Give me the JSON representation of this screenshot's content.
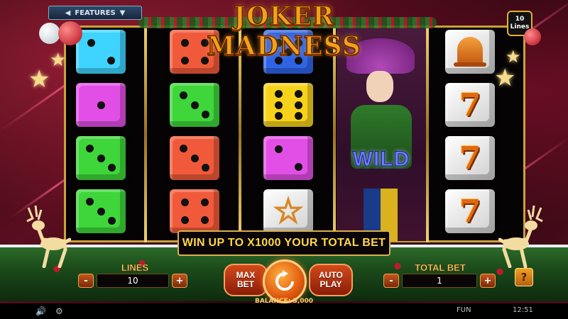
{
  "title": "JOKER MADNESS",
  "features_label": "FEATURES",
  "lines_badge": {
    "value": "10",
    "label": "Lines"
  },
  "wild_label": "WILD",
  "win_banner": "WIN UP TO X1000 YOUR TOTAL BET",
  "controls": {
    "lines_label": "LINES",
    "lines_value": "10",
    "max_bet_line1": "MAX",
    "max_bet_line2": "BET",
    "auto_play_line1": "AUTO",
    "auto_play_line2": "PLAY",
    "total_bet_label": "TOTAL BET",
    "total_bet_value": "1",
    "minus": "-",
    "plus": "+",
    "help": "?"
  },
  "balance": "BALANCE: 5,000",
  "statusbar": {
    "mode": "FUN",
    "clock": "12:51"
  },
  "reels": [
    [
      "die-cyan-2",
      "die-magenta-1",
      "die-green-3",
      "die-green-3"
    ],
    [
      "die-red-4",
      "die-green-3",
      "die-red-3",
      "die-red-4"
    ],
    [
      "die-blue-5",
      "die-yellow-6",
      "die-magenta-2",
      "star-white"
    ],
    [
      "wild-joker"
    ],
    [
      "bell-white",
      "seven-white",
      "seven-white",
      "seven-white"
    ]
  ],
  "colors": {
    "cyan": "#3fd4ff",
    "magenta": "#e24fe6",
    "green": "#3ed63a",
    "red": "#f05a3a",
    "blue": "#2f64e6",
    "yellow": "#f6d21a",
    "gold": "#f2a21a"
  }
}
